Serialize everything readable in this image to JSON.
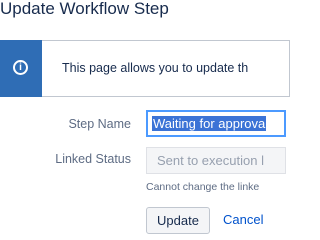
{
  "page": {
    "title": "Update Workflow Step"
  },
  "info": {
    "icon": "info-icon",
    "message": "This page allows you to update th"
  },
  "form": {
    "step_name_label": "Step Name",
    "step_name_value": "Waiting for approva",
    "linked_status_label": "Linked Status",
    "linked_status_value": "Sent to execution l",
    "linked_status_hint": "Cannot change the linke"
  },
  "actions": {
    "update_label": "Update",
    "cancel_label": "Cancel"
  },
  "colors": {
    "accent": "#2f6db5",
    "focus": "#4c9aff",
    "link": "#0052cc"
  }
}
